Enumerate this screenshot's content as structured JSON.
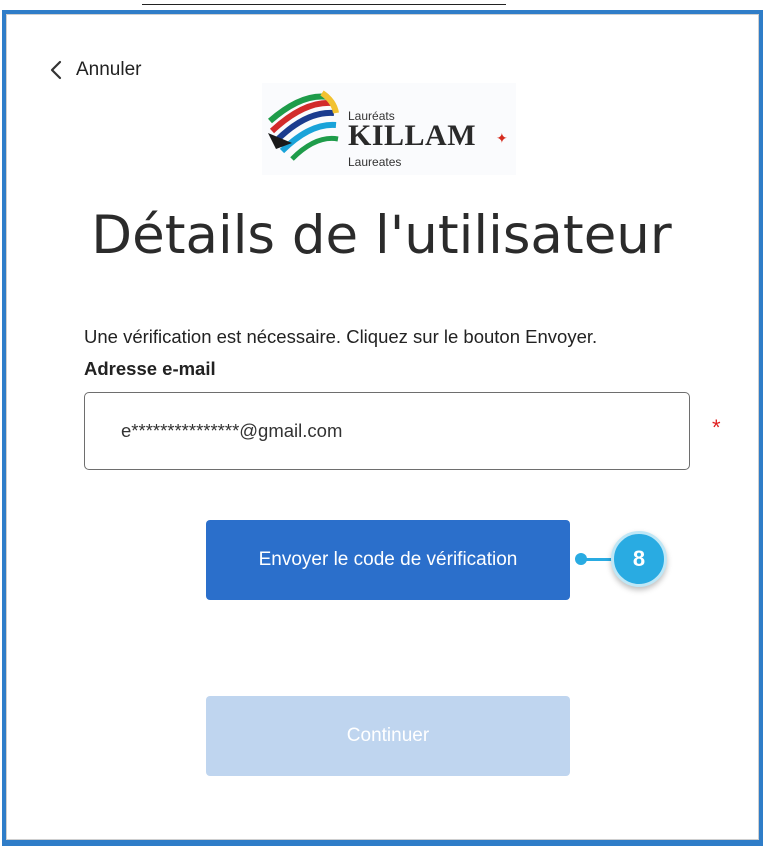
{
  "back": {
    "label": "Annuler",
    "icon": "chevron-left-icon"
  },
  "logo": {
    "text_top": "Lauréats",
    "text_main": "KILLAM",
    "text_bottom": "Laureates",
    "leaf_color": "#d52b1e"
  },
  "page": {
    "title": "Détails de l'utilisateur",
    "info": "Une vérification est nécessaire. Cliquez sur le bouton Envoyer."
  },
  "email": {
    "label": "Adresse e-mail",
    "value": "e***************@gmail.com",
    "required_marker": "*"
  },
  "buttons": {
    "send_label": "Envoyer le code de vérification",
    "continue_label": "Continuer"
  },
  "callout": {
    "number": "8",
    "color": "#29abe2"
  },
  "colors": {
    "frame": "#2f7dc8",
    "primary": "#2b6fcb",
    "disabled": "#bfd5ef"
  }
}
